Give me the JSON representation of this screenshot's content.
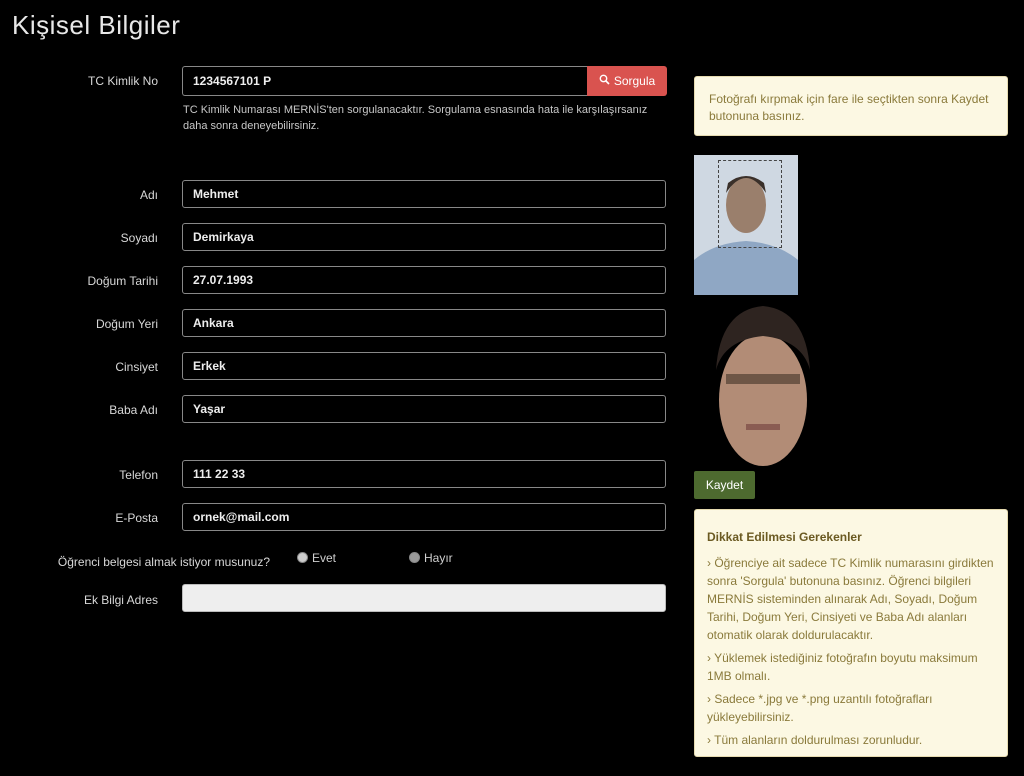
{
  "page": {
    "title": "Kişisel Bilgiler"
  },
  "tc": {
    "label": "TC Kimlik No",
    "value": "1234567101 P",
    "button": "Sorgula",
    "help": "TC Kimlik Numarası MERNİS'ten sorgulanacaktır. Sorgulama esnasında hata ile karşılaşırsanız daha sonra deneyebilirsiniz."
  },
  "fields": {
    "ad": {
      "label": "Adı",
      "value": "Mehmet"
    },
    "soyad": {
      "label": "Soyadı",
      "value": "Demirkaya"
    },
    "dogum_tarihi": {
      "label": "Doğum Tarihi",
      "value": "27.07.1993"
    },
    "dogum_yeri": {
      "label": "Doğum Yeri",
      "value": "Ankara"
    },
    "cinsiyet": {
      "label": "Cinsiyet",
      "value": "Erkek"
    },
    "baba_adi": {
      "label": "Baba Adı",
      "value": "Yaşar"
    },
    "telefon": {
      "label": "Telefon",
      "value": "111 22 33"
    },
    "eposta": {
      "label": "E-Posta",
      "value": "ornek@mail.com"
    },
    "soru": {
      "label": "Öğrenci belgesi almak istiyor musunuz?",
      "options": [
        "Evet",
        "Hayır"
      ],
      "selected": "Hayır"
    },
    "adres": {
      "label": "Ek Bilgi Adres",
      "value": ""
    }
  },
  "photo_note": "Fotoğrafı kırpmak için fare ile seçtikten sonra Kaydet butonuna basınız.",
  "save_button": "Kaydet",
  "info": {
    "title": "Dikkat Edilmesi Gerekenler",
    "items": [
      "› Öğrenciye ait sadece TC Kimlik numarasını girdikten sonra 'Sorgula' butonuna basınız. Öğrenci bilgileri MERNİS sisteminden alınarak Adı, Soyadı, Doğum Tarihi, Doğum Yeri, Cinsiyeti ve Baba Adı alanları otomatik olarak doldurulacaktır.",
      "› Yüklemek istediğiniz fotoğrafın boyutu maksimum 1MB olmalı.",
      "› Sadece *.jpg ve *.png uzantılı fotoğrafları yükleyebilirsiniz.",
      "› Tüm alanların doldurulması zorunludur."
    ]
  },
  "colors": {
    "danger": "#d9534f",
    "success": "#4d6a2f",
    "note_bg": "#fcf8e3"
  }
}
